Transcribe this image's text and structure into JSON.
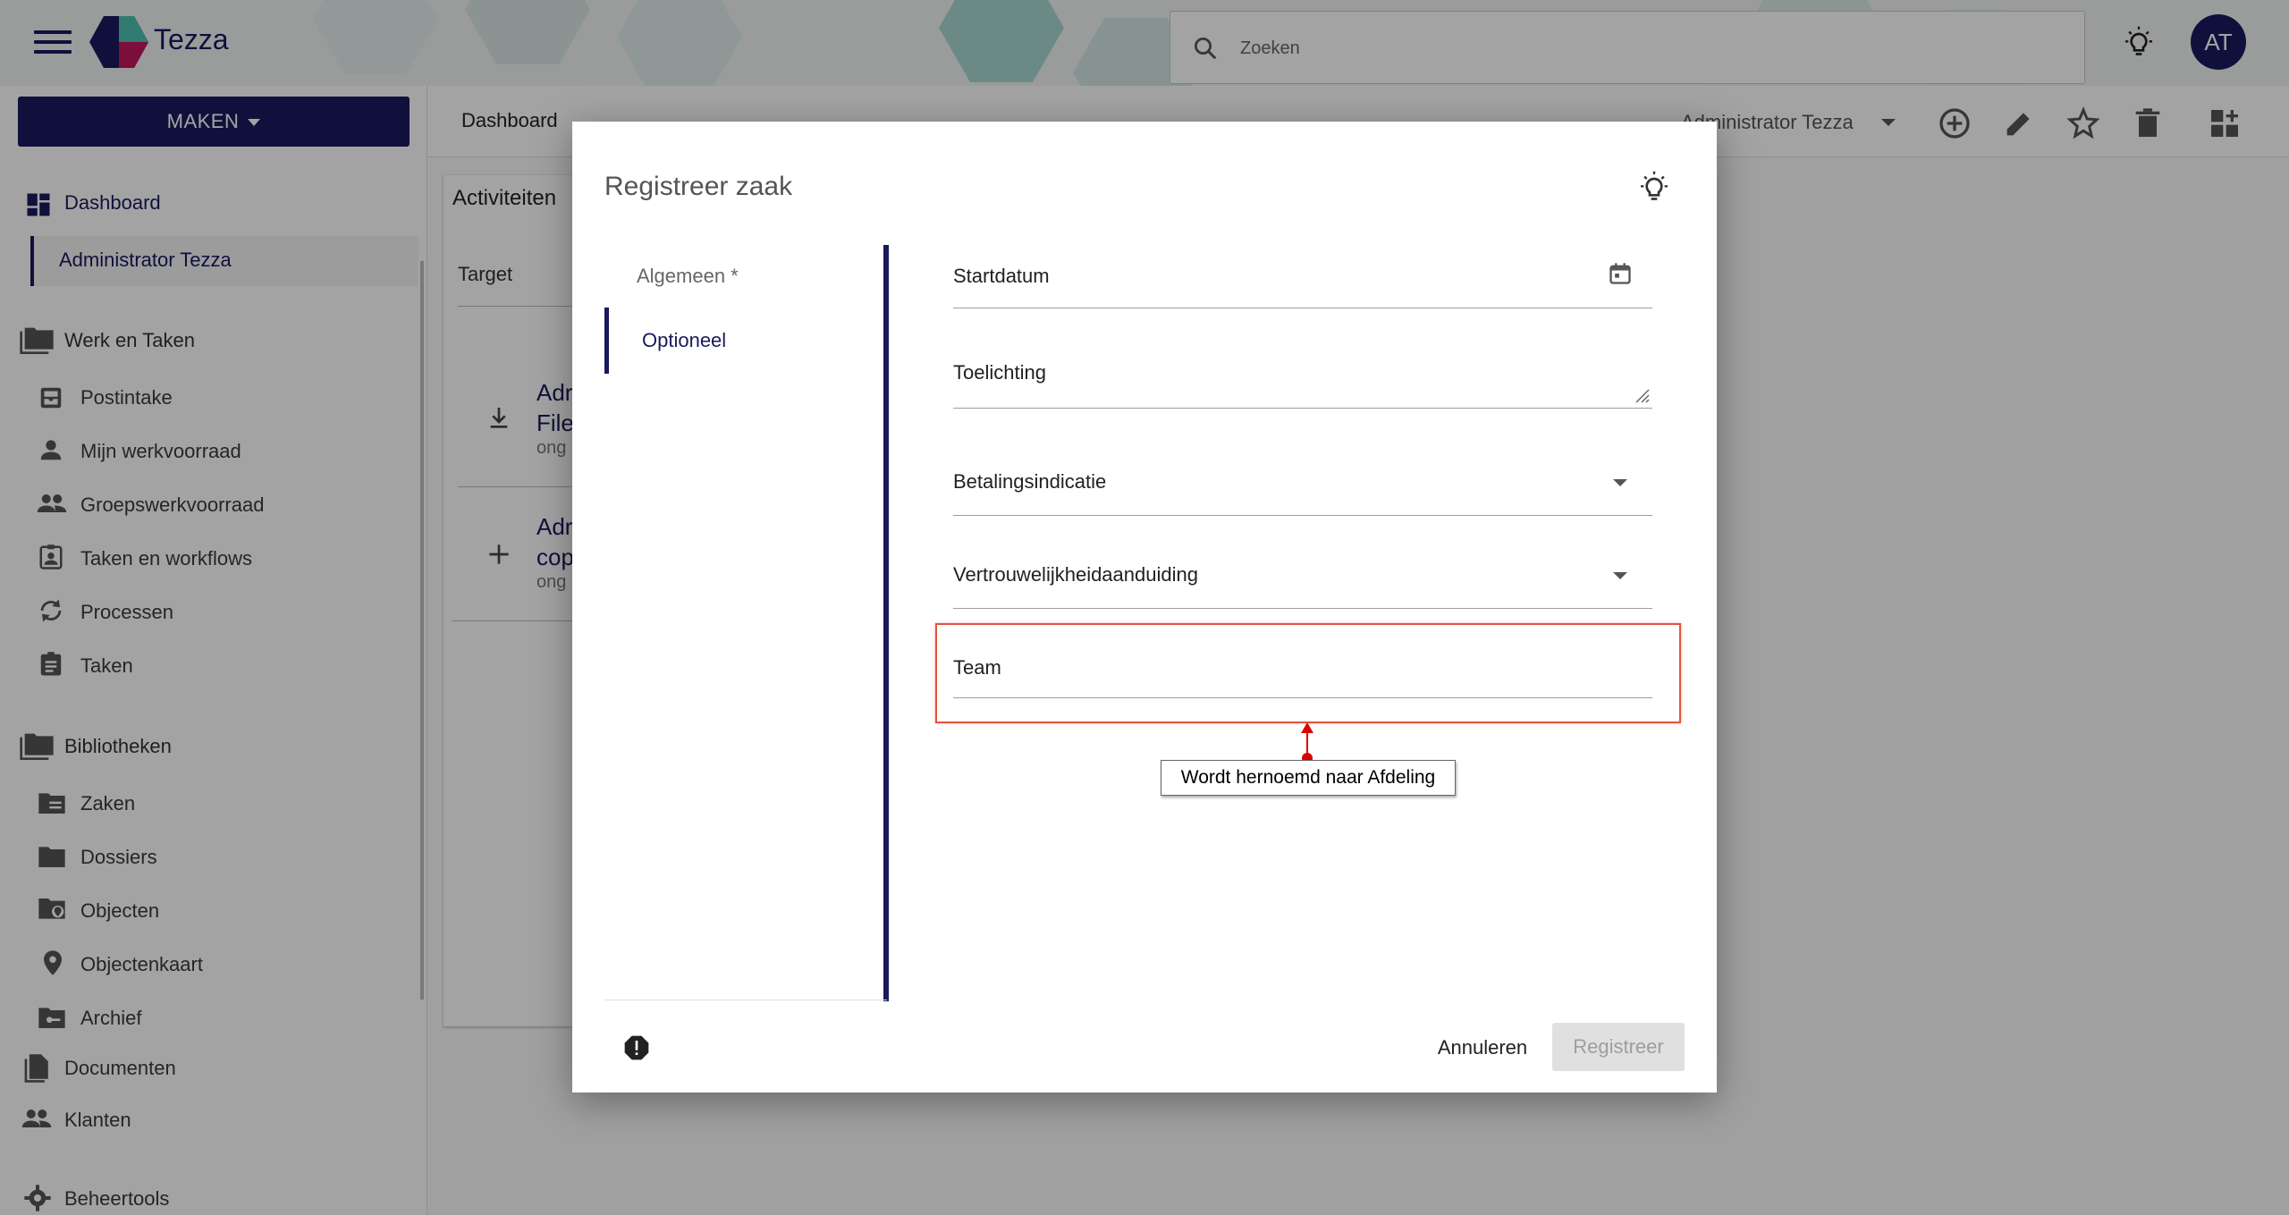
{
  "app": {
    "brand": "Tezza",
    "search_placeholder": "Zoeken",
    "avatar_initials": "AT",
    "accent": "#1a1a5e"
  },
  "sidebar": {
    "create_button": "MAKEN",
    "dashboard": "Dashboard",
    "dashboard_sub": "Administrator Tezza",
    "work_group": "Werk en Taken",
    "work_items": [
      {
        "label": "Postintake",
        "icon": "inbox-icon"
      },
      {
        "label": "Mijn werkvoorraad",
        "icon": "person-icon"
      },
      {
        "label": "Groepswerkvoorraad",
        "icon": "group-icon"
      },
      {
        "label": "Taken en workflows",
        "icon": "clipboard-person-icon"
      },
      {
        "label": "Processen",
        "icon": "sync-icon"
      },
      {
        "label": "Taken",
        "icon": "assignment-icon"
      }
    ],
    "library_group": "Bibliotheken",
    "library_items": [
      {
        "label": "Zaken",
        "icon": "folder-list-icon"
      },
      {
        "label": "Dossiers",
        "icon": "folder-icon"
      },
      {
        "label": "Objecten",
        "icon": "folder-pin-icon"
      },
      {
        "label": "Objectenkaart",
        "icon": "map-pin-icon"
      },
      {
        "label": "Archief",
        "icon": "folder-key-icon"
      }
    ],
    "documents": "Documenten",
    "clients": "Klanten",
    "admin_tools": "Beheertools"
  },
  "main": {
    "breadcrumb": "Dashboard",
    "user_select": "Administrator Tezza",
    "card_title": "Activiteiten",
    "card_target": "Target",
    "row1_title_a": "Adr",
    "row1_title_b": "File",
    "row1_sub": "ong",
    "row2_title_a": "Adr",
    "row2_title_b": "cop",
    "row2_sub": "ong"
  },
  "dialog": {
    "title": "Registreer zaak",
    "nav": [
      {
        "label": "Algemeen *"
      },
      {
        "label": "Optioneel"
      }
    ],
    "fields": {
      "startdatum": "Startdatum",
      "toelichting": "Toelichting",
      "betalingsindicatie": "Betalingsindicatie",
      "vertrouwelijkheid": "Vertrouwelijkheidaanduiding",
      "team": "Team"
    },
    "annotation": "Wordt hernoemd naar Afdeling",
    "cancel_label": "Annuleren",
    "register_label": "Registreer"
  }
}
